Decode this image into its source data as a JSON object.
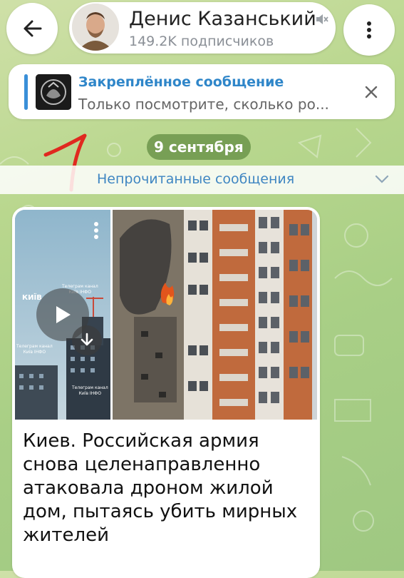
{
  "header": {
    "channel_name": "Денис Казанський",
    "subscribers": "149.2K подписчиков",
    "back_icon": "arrow-left-icon",
    "menu_icon": "more-vertical-icon",
    "mute_icon": "mute-icon"
  },
  "pinned": {
    "title": "Закреплённое сообщение",
    "preview": "Только посмотрите, сколько ро...",
    "accent_color": "#3a8fd8"
  },
  "date_separator": "9 сентября",
  "unread_label": "Непрочитанные сообщения",
  "post": {
    "video_watermark_logo": "КИЇВ",
    "video_watermark_lines": [
      "Телеграм канал",
      "Київ IНФО"
    ],
    "text": "Киев. Российская армия снова целенаправленно атаковала дроном жилой дом, пытаясь убить мирных жителей"
  },
  "colors": {
    "link_blue": "#2f86c9",
    "date_pill_bg": "#628c42",
    "wallpaper_green": "#b9d78e"
  }
}
